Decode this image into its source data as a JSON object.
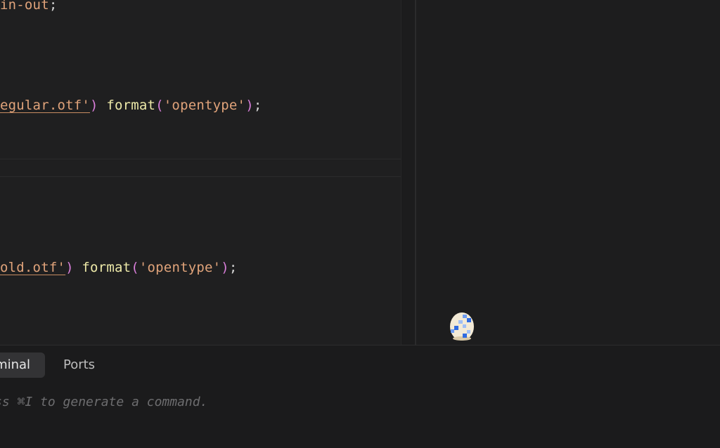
{
  "editor": {
    "line1": {
      "value": "in-out",
      "end": ";"
    },
    "line2": {
      "url": "egular.otf'",
      "close": ")",
      "fn": "format",
      "open": "(",
      "arg": "'opentype'",
      "close2": ")",
      "end": ";"
    },
    "line3": {
      "url": "old.otf'",
      "close": ")",
      "fn": "format",
      "open": "(",
      "arg": "'opentype'",
      "close2": ")",
      "end": ";"
    }
  },
  "panel": {
    "tabs": [
      {
        "label": "rminal",
        "active": true
      },
      {
        "label": "Ports",
        "active": false
      }
    ],
    "terminal_placeholder": "ss ⌘I to generate a command."
  },
  "pet": {
    "icon": "pixel-egg-icon",
    "colors": [
      "#f3ead6",
      "#2f6be0"
    ]
  }
}
